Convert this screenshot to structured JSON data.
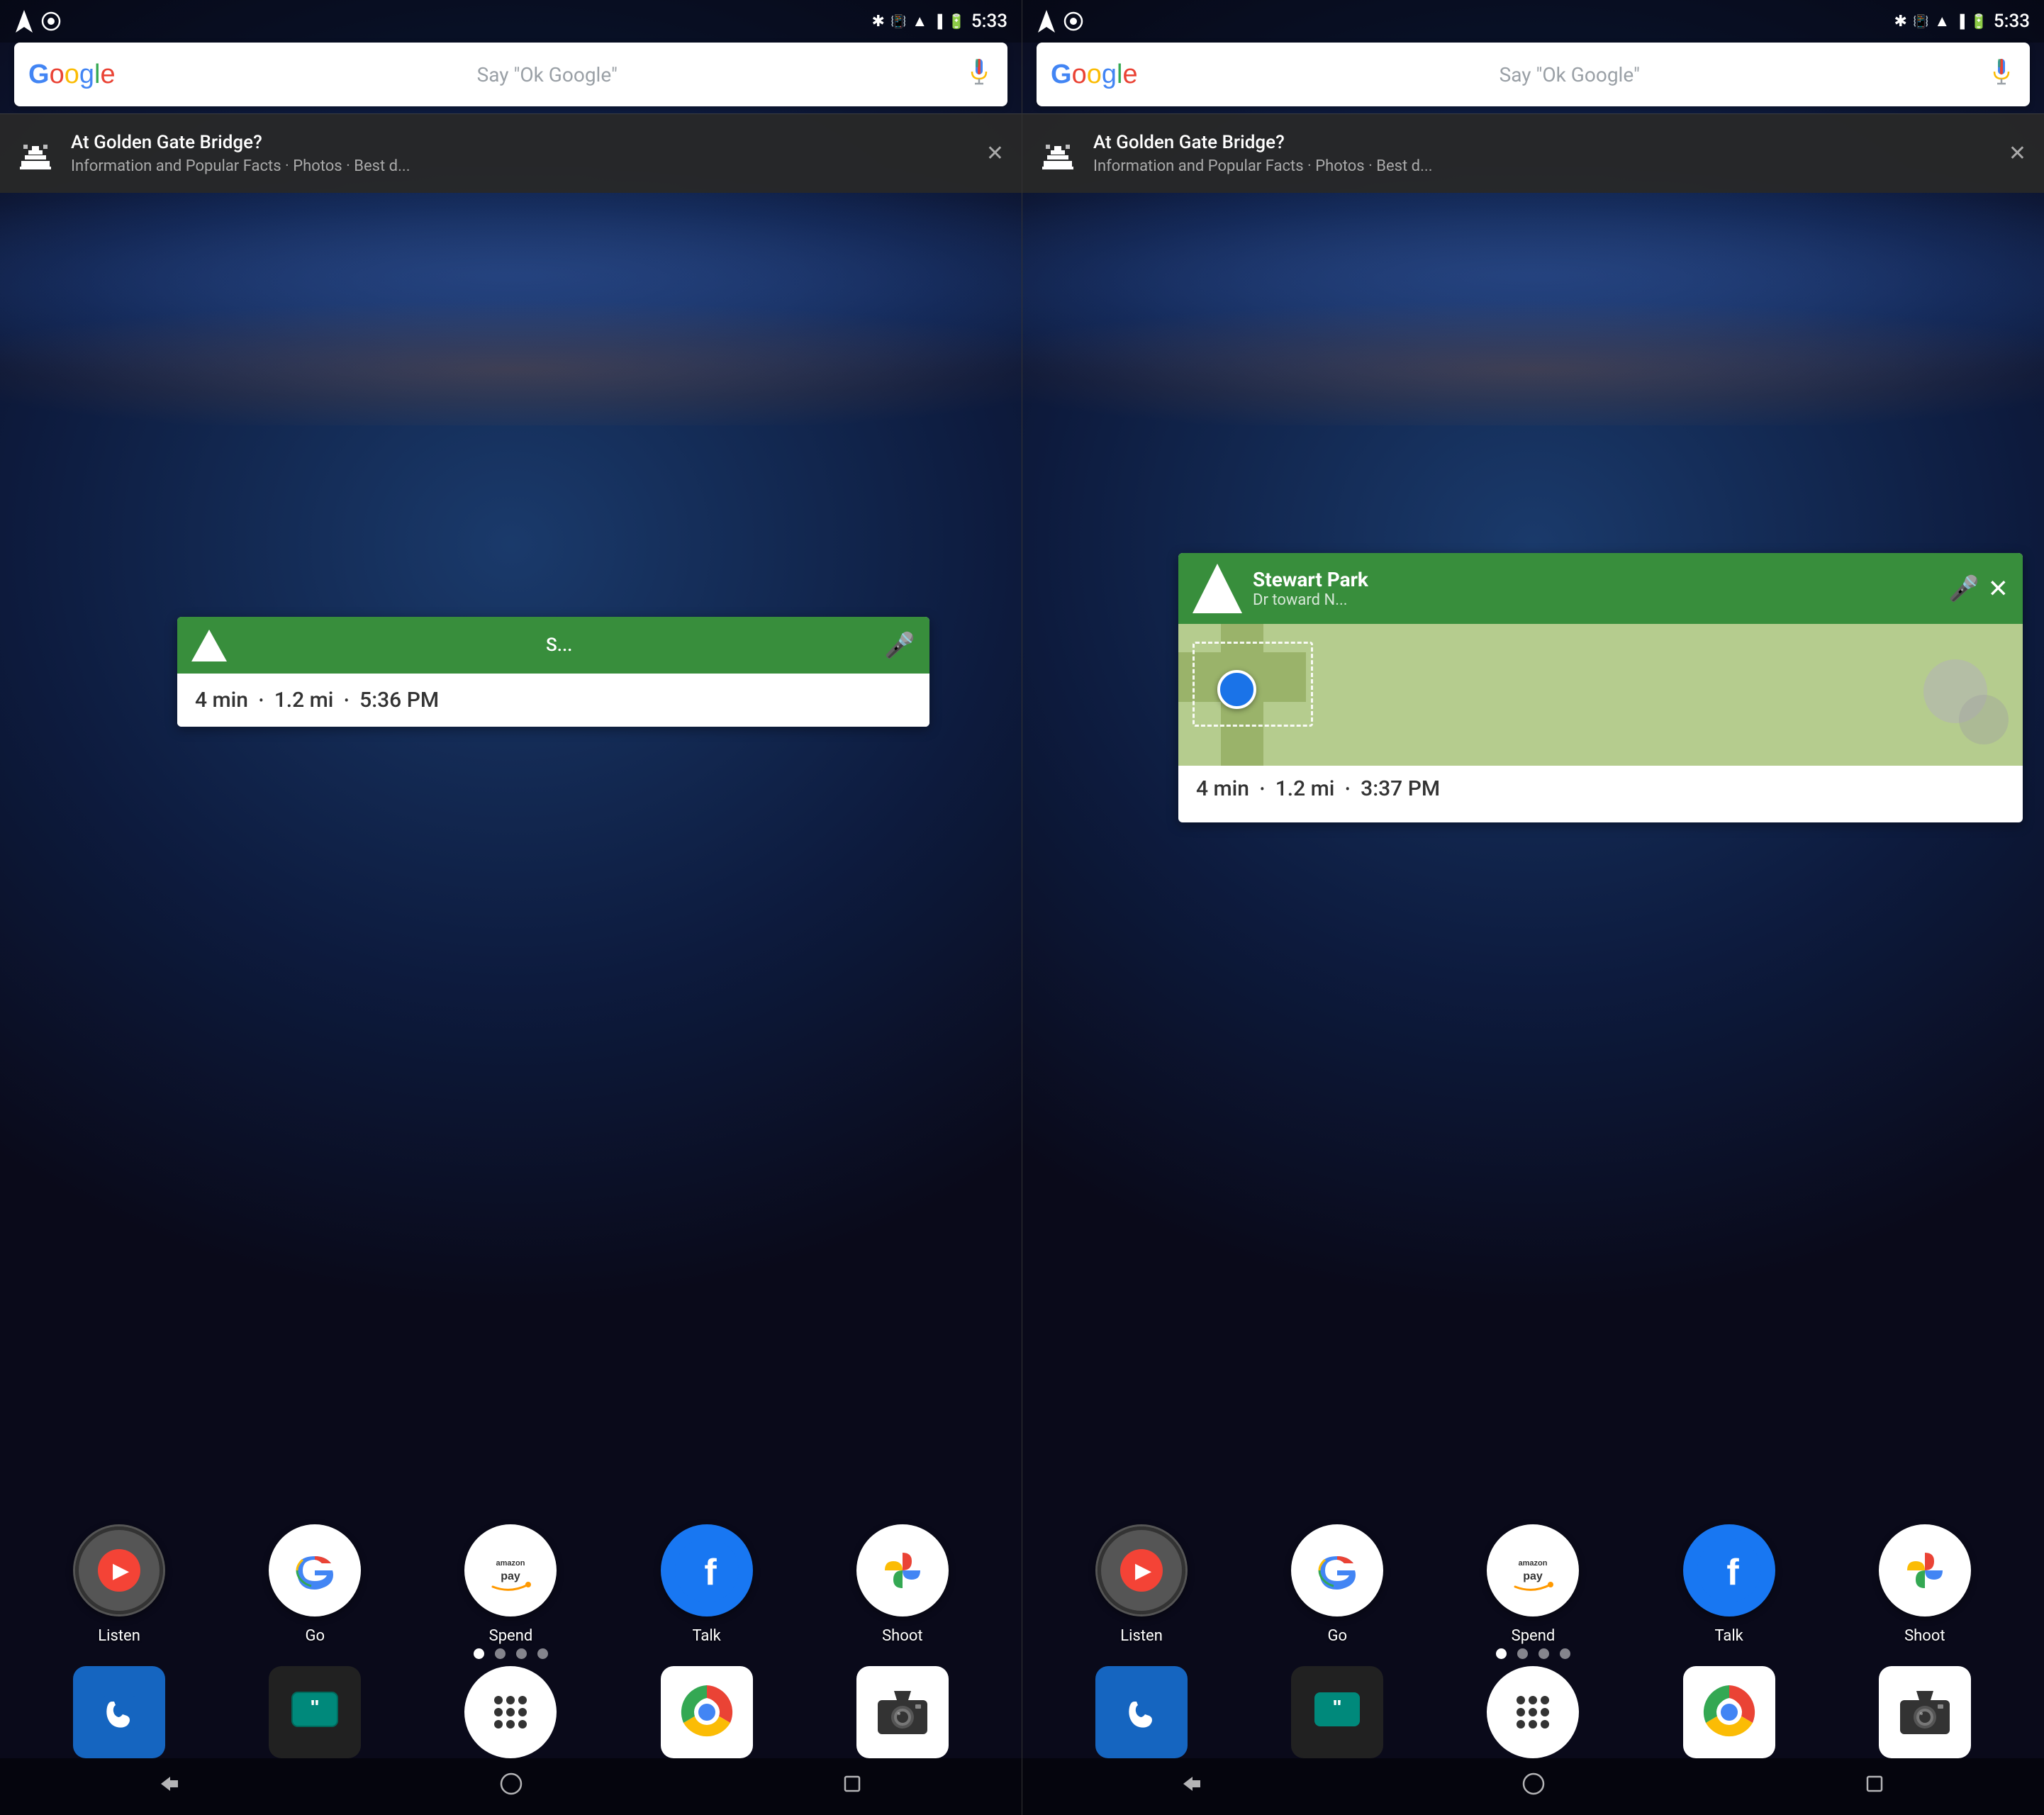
{
  "screens": [
    {
      "id": "left",
      "statusBar": {
        "time": "5:33",
        "icons": [
          "bluetooth",
          "vibrate",
          "wifi",
          "signal",
          "battery"
        ]
      },
      "searchBar": {
        "placeholder": "Say \"Ok Google\"",
        "hasMic": true
      },
      "notification": {
        "title": "At Golden Gate Bridge?",
        "subtitle": "Information and Popular Facts · Photos · Best d..."
      },
      "navWidget": {
        "destination": "S...",
        "hasMic": true,
        "detail1": "4 min",
        "detail2": "1.2 mi",
        "detail3": "5:36 PM"
      },
      "apps": [
        {
          "name": "Listen",
          "type": "listen"
        },
        {
          "name": "Go",
          "type": "go"
        },
        {
          "name": "Spend",
          "type": "amazon"
        },
        {
          "name": "Talk",
          "type": "facebook"
        },
        {
          "name": "Shoot",
          "type": "photos"
        }
      ],
      "dots": [
        true,
        false,
        false,
        false
      ],
      "bottomApps": [
        {
          "name": "phone",
          "type": "phone"
        },
        {
          "name": "messages",
          "type": "messages"
        },
        {
          "name": "launcher",
          "type": "launcher"
        },
        {
          "name": "chrome",
          "type": "chrome"
        },
        {
          "name": "camera",
          "type": "camera"
        }
      ]
    },
    {
      "id": "right",
      "statusBar": {
        "time": "5:33",
        "icons": [
          "bluetooth",
          "vibrate",
          "wifi",
          "signal",
          "battery"
        ]
      },
      "searchBar": {
        "placeholder": "Say \"Ok Google\"",
        "hasMic": true
      },
      "notification": {
        "title": "At Golden Gate Bridge?",
        "subtitle": "Information and Popular Facts · Photos · Best d..."
      },
      "navWidget": {
        "destination": "Stewart Park",
        "destinationSub": "Dr toward N...",
        "hasMic": true,
        "detail1": "4 min",
        "detail2": "1.2 mi",
        "detail3": "3:37 PM"
      },
      "apps": [
        {
          "name": "Listen",
          "type": "listen"
        },
        {
          "name": "Go",
          "type": "go"
        },
        {
          "name": "Spend",
          "type": "amazon"
        },
        {
          "name": "Talk",
          "type": "facebook"
        },
        {
          "name": "Shoot",
          "type": "photos"
        }
      ],
      "dots": [
        true,
        false,
        false,
        false
      ],
      "bottomApps": [
        {
          "name": "phone",
          "type": "phone"
        },
        {
          "name": "messages",
          "type": "messages"
        },
        {
          "name": "launcher",
          "type": "launcher"
        },
        {
          "name": "chrome",
          "type": "chrome"
        },
        {
          "name": "camera",
          "type": "camera"
        }
      ]
    }
  ],
  "labels": {
    "listen": "Listen",
    "go": "Go",
    "spend": "Spend",
    "talk": "Talk",
    "shoot": "Shoot",
    "ok_google": "Say \"Ok Google\"",
    "notif_title": "At Golden Gate Bridge?",
    "notif_sub": "Information and Popular Facts · Photos · Best d...",
    "nav_dest_left": "S...",
    "nav_dest_right": "Stewart Park",
    "nav_dest_right_sub": "Dr toward N...",
    "nav_min1": "4 min",
    "nav_mi1": "1.2 mi",
    "nav_time1": "5:36 PM",
    "nav_min2": "4 min",
    "nav_mi2": "1.2 mi",
    "nav_time2": "3:37 PM",
    "time": "5:33"
  },
  "colors": {
    "google_blue": "#4285F4",
    "google_red": "#EA4335",
    "google_yellow": "#FBBC05",
    "google_green": "#34A853",
    "nav_green": "#388e3c",
    "fb_blue": "#1877f2"
  }
}
